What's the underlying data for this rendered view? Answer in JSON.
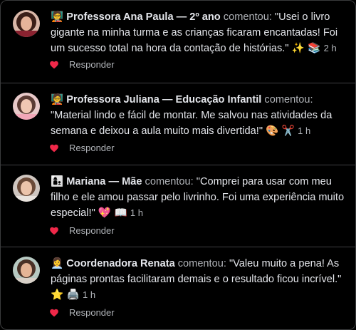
{
  "comments": [
    {
      "badge": "🧑‍🏫",
      "author": "Professora Ana Paula — 2º ano",
      "verb": "comentou:",
      "body": "\"Usei o livro gigante na minha turma e as crianças ficaram encantadas! Foi um sucesso total na hora da contação de histórias.\"",
      "emojis": "✨ 📚",
      "time": "2 h",
      "reply": "Responder"
    },
    {
      "badge": "🧑‍🏫",
      "author": "Professora Juliana — Educação Infantil",
      "verb": "comentou:",
      "body": "\"Material lindo e fácil de montar. Me salvou nas atividades da semana e deixou a aula muito mais divertida!\"",
      "emojis": "🎨 ✂️",
      "time": "1 h",
      "reply": "Responder"
    },
    {
      "badge": "👩‍👦",
      "author": "Mariana — Mãe",
      "verb": "comentou:",
      "body": "\"Comprei para usar com meu filho e ele amou passar pelo livrinho. Foi uma experiência muito especial!\"",
      "emojis": "💖 📖",
      "time": "1 h",
      "reply": "Responder"
    },
    {
      "badge": "👩‍💼",
      "author": "Coordenadora Renata",
      "verb": "comentou:",
      "body": "\"Valeu muito a pena! As páginas prontas facilitaram demais e o resultado ficou incrível.\"",
      "emojis": "⭐ 🖨️",
      "time": "1 h",
      "reply": "Responder"
    }
  ],
  "colors": {
    "heart": "#f02849",
    "muted": "#b0b3b8",
    "text": "#e4e6eb"
  }
}
